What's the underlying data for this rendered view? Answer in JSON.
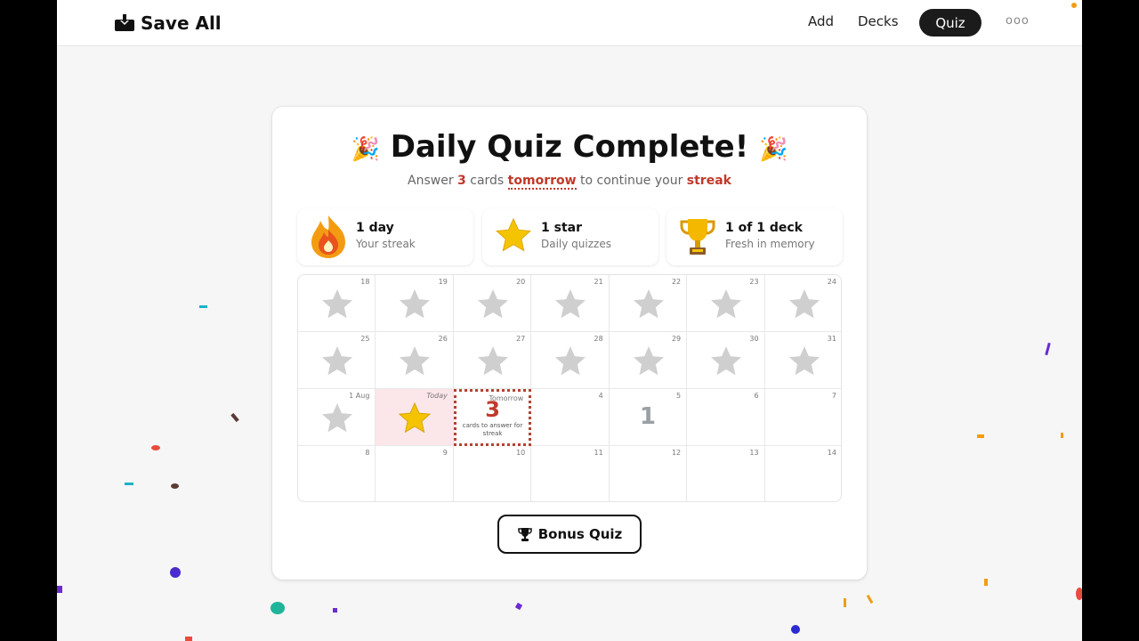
{
  "nav": {
    "logo_text": "Save All",
    "links": [
      "Add",
      "Decks"
    ],
    "active": "Quiz",
    "more": "ooo"
  },
  "header": {
    "title": "Daily Quiz Complete!",
    "party_emoji": "🎉",
    "subtitle": {
      "p1": "Answer ",
      "count": "3",
      "p2": " cards ",
      "when": "tomorrow",
      "p3": " to continue your ",
      "goal": "streak"
    }
  },
  "stats": [
    {
      "icon": "flame-icon",
      "value": "1 day",
      "label": "Your streak"
    },
    {
      "icon": "star-icon",
      "value": "1 star",
      "label": "Daily quizzes"
    },
    {
      "icon": "trophy-icon",
      "value": "1 of 1 deck",
      "label": "Fresh in memory"
    }
  ],
  "calendar": {
    "rows": [
      [
        {
          "d": "18",
          "t": "star-grey"
        },
        {
          "d": "19",
          "t": "star-grey"
        },
        {
          "d": "20",
          "t": "star-grey"
        },
        {
          "d": "21",
          "t": "star-grey"
        },
        {
          "d": "22",
          "t": "star-grey"
        },
        {
          "d": "23",
          "t": "star-grey"
        },
        {
          "d": "24",
          "t": "star-grey"
        }
      ],
      [
        {
          "d": "25",
          "t": "star-grey"
        },
        {
          "d": "26",
          "t": "star-grey"
        },
        {
          "d": "27",
          "t": "star-grey"
        },
        {
          "d": "28",
          "t": "star-grey"
        },
        {
          "d": "29",
          "t": "star-grey"
        },
        {
          "d": "30",
          "t": "star-grey"
        },
        {
          "d": "31",
          "t": "star-grey"
        }
      ],
      [
        {
          "d": "1 Aug",
          "t": "star-grey"
        },
        {
          "d": "Today",
          "t": "star-gold"
        },
        {
          "d": "Tomorrow",
          "t": "tomorrow",
          "big": "3",
          "note": "cards to answer for streak"
        },
        {
          "d": "4",
          "t": "empty"
        },
        {
          "d": "5",
          "t": "count",
          "big": "1"
        },
        {
          "d": "6",
          "t": "empty"
        },
        {
          "d": "7",
          "t": "empty"
        }
      ],
      [
        {
          "d": "8",
          "t": "empty"
        },
        {
          "d": "9",
          "t": "empty"
        },
        {
          "d": "10",
          "t": "empty"
        },
        {
          "d": "11",
          "t": "empty"
        },
        {
          "d": "12",
          "t": "empty"
        },
        {
          "d": "13",
          "t": "empty"
        },
        {
          "d": "14",
          "t": "empty"
        }
      ]
    ]
  },
  "bonus": {
    "label": "Bonus Quiz",
    "icon": "trophy-icon"
  },
  "colors": {
    "accent": "#c0392b",
    "gold": "#f5c400",
    "grey_star": "#cfcfcf",
    "today_bg": "#fbe6ea"
  }
}
